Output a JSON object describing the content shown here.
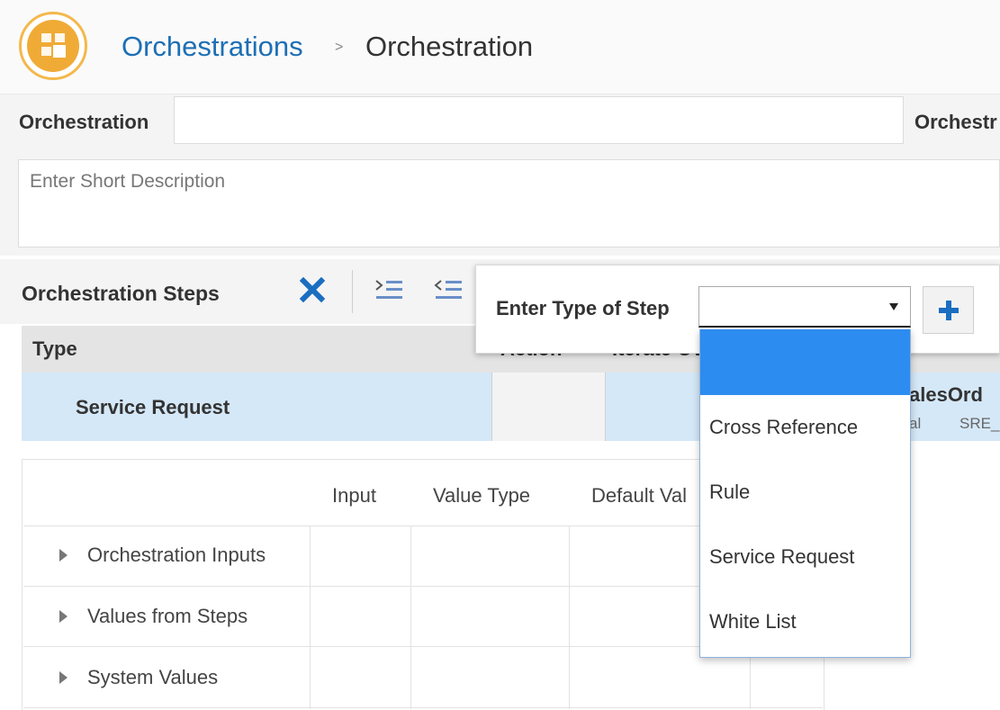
{
  "breadcrumb": {
    "parent": "Orchestrations",
    "separator": ">",
    "current": "Orchestration"
  },
  "form": {
    "orchestration_label": "Orchestration",
    "orchestration_value": "",
    "right_label": "Orchestr",
    "description_placeholder": "Enter Short Description"
  },
  "steps": {
    "title": "Orchestration Steps",
    "columns": [
      "Type",
      "Action",
      "Iterate Ov"
    ],
    "row": {
      "type": "Service Request",
      "name_fragment": "alesOrd",
      "sub1": "al",
      "sub2": "SRE_"
    }
  },
  "lower_table": {
    "headers": [
      "Input",
      "Value Type",
      "Default Val"
    ],
    "rows": [
      "Orchestration Inputs",
      "Values from Steps",
      "System Values"
    ]
  },
  "popup": {
    "label": "Enter Type of Step",
    "selected": "",
    "options": [
      "",
      "Cross Reference",
      "Rule",
      "Service Request",
      "White List"
    ]
  },
  "colors": {
    "accent": "#1d6fb5",
    "logo": "#f0ab36",
    "highlight": "#2d8cf0",
    "row_selected": "#d5e8f8"
  },
  "icons": {
    "delete": "close-icon",
    "indent": "indent-icon",
    "outdent": "outdent-icon",
    "add": "plus-icon",
    "caret": "caret-down-icon"
  }
}
